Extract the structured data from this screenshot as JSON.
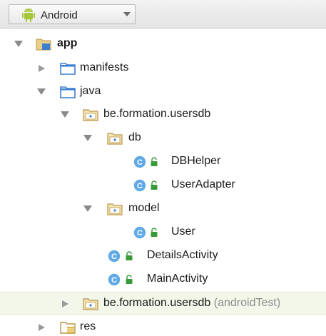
{
  "toolbar": {
    "view_label": "Android",
    "android_icon": "android-icon",
    "dropdown_icon": "dropdown-arrow-icon"
  },
  "tree": {
    "app": "app",
    "manifests": "manifests",
    "java": "java",
    "package_main": "be.formation.usersdb",
    "db": "db",
    "dbhelper": "DBHelper",
    "useradapter": "UserAdapter",
    "model": "model",
    "user": "User",
    "detailsactivity": "DetailsActivity",
    "mainactivity": "MainActivity",
    "package_test": "be.formation.usersdb",
    "package_test_suffix": "(androidTest)",
    "res": "res"
  },
  "colors": {
    "folder_blue": "#3d7fcf",
    "folder_tan": "#b99646",
    "class_circle": "#5fa9e6",
    "lock_green": "#3a9a3a",
    "android_green": "#a4c639",
    "selection": "#f3f7ea"
  }
}
